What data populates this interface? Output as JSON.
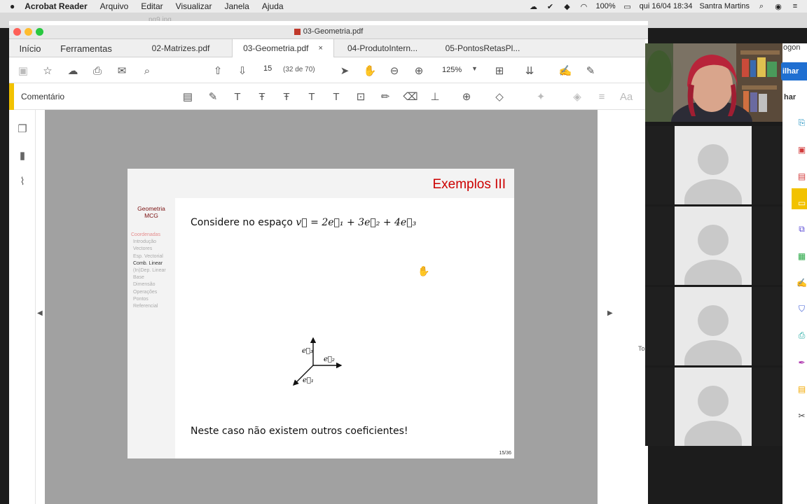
{
  "menubar": {
    "apple": "",
    "app": "Acrobat Reader",
    "items": [
      "Arquivo",
      "Editar",
      "Visualizar",
      "Janela",
      "Ajuda"
    ],
    "battery": "100%",
    "datetime": "qui 16/04  18:34",
    "user": "Santra Martins"
  },
  "background_window": {
    "title": "pg9.jpg"
  },
  "window": {
    "title": "03-Geometria.pdf"
  },
  "tabs": {
    "home": "Início",
    "tools": "Ferramentas",
    "docs": [
      {
        "label": "02-Matrizes.pdf"
      },
      {
        "label": "03-Geometria.pdf",
        "close": "×"
      },
      {
        "label": "04-ProdutoIntern..."
      },
      {
        "label": "05-PontosRetasPl..."
      }
    ]
  },
  "toolbar": {
    "page_current": "15",
    "page_total": "(32 de 70)",
    "zoom": "125%"
  },
  "comment_toolbar": {
    "label": "Comentário"
  },
  "slide": {
    "title": "Exemplos III",
    "course_line1": "Geometria",
    "course_line2": "MCG",
    "nav": [
      {
        "label": "Coordenadas",
        "kind": "sec"
      },
      {
        "label": "Introdução",
        "kind": "sub"
      },
      {
        "label": "Vectores",
        "kind": "sub"
      },
      {
        "label": "Esp. Vectorial",
        "kind": "sub"
      },
      {
        "label": "Comb. Linear",
        "kind": "cur"
      },
      {
        "label": "(In)Dep. Linear",
        "kind": "sub"
      },
      {
        "label": "Base",
        "kind": "sub"
      },
      {
        "label": "Dimensão",
        "kind": "sub"
      },
      {
        "label": "Operações",
        "kind": "sub"
      },
      {
        "label": "Pontos",
        "kind": "sub"
      },
      {
        "label": "Referencial",
        "kind": "sub"
      }
    ],
    "text1_prefix": "Considere no espaço ",
    "text1_math": "v⃗ = 2e⃗₁ + 3e⃗₂ + 4e⃗₃",
    "axes_labels": {
      "e1": "e⃗₁",
      "e2": "e⃗₂",
      "e3": "e⃗₃"
    },
    "text2": "Neste caso não existem outros coeficientes!",
    "page": "15/36"
  },
  "right_panel": {
    "button1": "ilhar",
    "button2": "har",
    "logon": "ogon",
    "partial": "To"
  },
  "colors": {
    "slide_title": "#cc0000",
    "accent_comment": "#f2c200",
    "viewer_bg": "#a1a1a1",
    "zoom_button": "#1f6fd1"
  }
}
